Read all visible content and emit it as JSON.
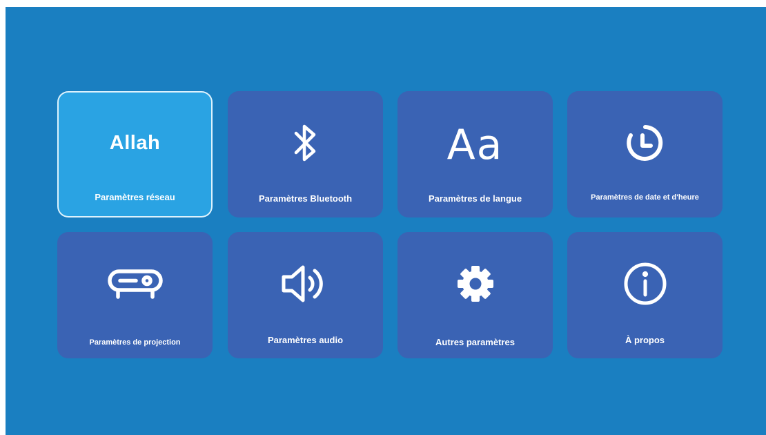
{
  "tiles": [
    {
      "key": "network",
      "label": "Paramètres réseau",
      "icon": "network-text",
      "icon_text": "Allah",
      "selected": true
    },
    {
      "key": "bluetooth",
      "label": "Paramètres Bluetooth",
      "icon": "bluetooth-icon",
      "selected": false
    },
    {
      "key": "language",
      "label": "Paramètres de langue",
      "icon": "language-icon",
      "icon_text": "Aa",
      "selected": false
    },
    {
      "key": "datetime",
      "label": "Paramètres de date et d'heure",
      "icon": "clock-icon",
      "selected": false
    },
    {
      "key": "projection",
      "label": "Paramètres de projection",
      "icon": "projector-icon",
      "selected": false
    },
    {
      "key": "audio",
      "label": "Paramètres audio",
      "icon": "speaker-icon",
      "selected": false
    },
    {
      "key": "other",
      "label": "Autres paramètres",
      "icon": "gear-icon",
      "selected": false
    },
    {
      "key": "about",
      "label": "À propos",
      "icon": "info-icon",
      "selected": false
    }
  ],
  "colors": {
    "background": "#1a7fc1",
    "tile": "#3a63b4",
    "tile_selected": "#2aa3e3",
    "foreground": "#ffffff"
  }
}
